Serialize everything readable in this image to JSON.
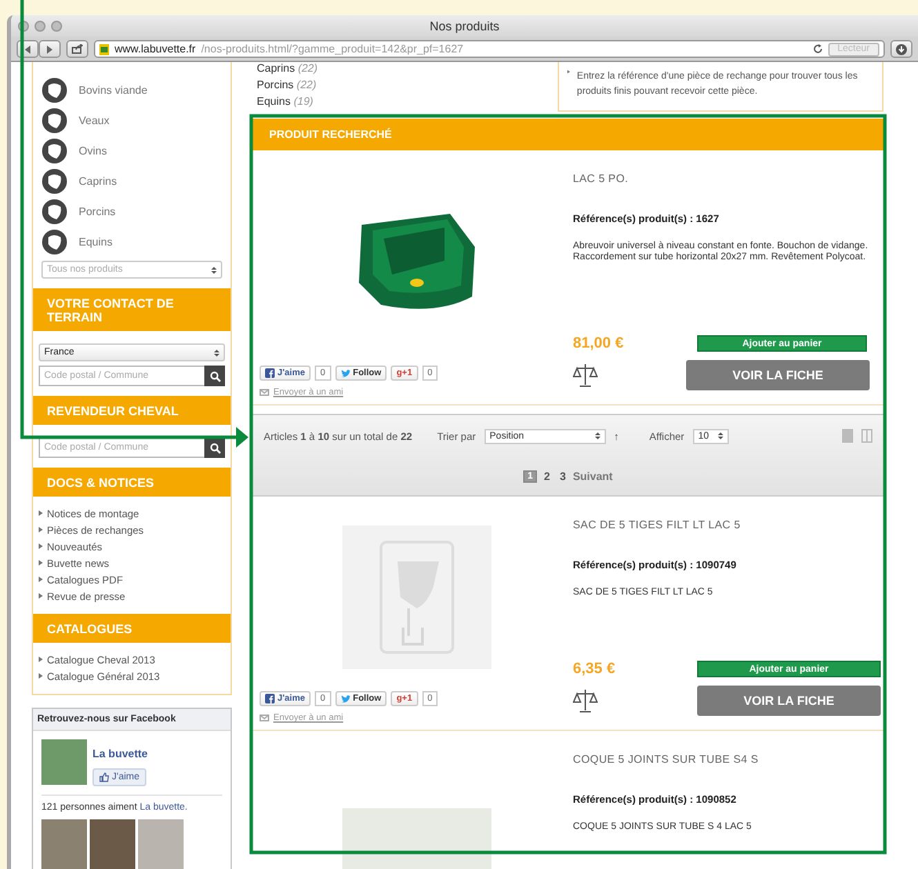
{
  "browser": {
    "title": "Nos produits",
    "url_domain": "www.labuvette.fr",
    "url_path": "/nos-produits.html/?gamme_produit=142&pr_pf=1627",
    "reader_button": "Lecteur"
  },
  "sidebar": {
    "categories": [
      {
        "label": "Bovins viande"
      },
      {
        "label": "Veaux"
      },
      {
        "label": "Ovins"
      },
      {
        "label": "Caprins"
      },
      {
        "label": "Porcins"
      },
      {
        "label": "Equins"
      }
    ],
    "product_select": {
      "value": "Tous nos produits"
    },
    "sections": [
      {
        "kind": "contact",
        "title": "VOTRE CONTACT DE TERRAIN",
        "country": "France",
        "placeholder": "Code postal / Commune"
      },
      {
        "kind": "search",
        "title": "REVENDEUR CHEVAL",
        "placeholder": "Code postal / Commune"
      },
      {
        "kind": "links",
        "title": "DOCS & NOTICES",
        "links": [
          "Notices de montage",
          "Pièces de rechanges",
          "Nouveautés",
          "Buvette news",
          "Catalogues PDF",
          "Revue de presse"
        ]
      },
      {
        "kind": "links",
        "title": "CATALOGUES",
        "links": [
          "Catalogue Cheval 2013",
          "Catalogue Général 2013"
        ]
      }
    ],
    "facebook": {
      "title": "Retrouvez-nous sur Facebook",
      "page_name": "La buvette",
      "like_button": "J'aime",
      "likes_text": "121 personnes aiment",
      "likes_link": "La buvette."
    }
  },
  "main": {
    "filters": [
      {
        "label": "Caprins",
        "count": "(22)"
      },
      {
        "label": "Porcins",
        "count": "(22)"
      },
      {
        "label": "Equins",
        "count": "(19)"
      }
    ],
    "hint": "Entrez la référence d'une pièce de rechange pour trouver tous les produits finis pouvant recevoir cette pièce.",
    "featured_title": "PRODUIT RECHERCHÉ",
    "toolbar": {
      "summary": "Articles **1** à **10** sur un total de **22**",
      "sort_label": "Trier par",
      "sort_value": "Position",
      "sort_arrow": "↑",
      "show_label": "Afficher",
      "show_value": "10"
    },
    "pagination": [
      {
        "label": "1",
        "selected": true
      },
      {
        "label": "2",
        "selected": false
      },
      {
        "label": "3",
        "selected": false
      }
    ],
    "next_link": "Suivant",
    "products": [
      {
        "kind": "trough",
        "name": "LAC 5 PO.",
        "reference": "Référence(s) produit(s) : 1627",
        "description": "Abreuvoir universel à niveau constant en fonte. Bouchon de vidange. Raccordement sur tube horizontal 20x27 mm. Revêtement Polycoat.",
        "price": "81,00 €",
        "cart_button": "Ajouter au panier",
        "details_button": "VOIR LA FICHE",
        "like": "J'aime",
        "like_count": "0",
        "follow": "Follow",
        "plus": "g+1",
        "plus_count": "0",
        "send_link": "Envoyer à un ami"
      },
      {
        "kind": "placeholder",
        "name": "SAC DE 5 TIGES FILT LT LAC 5",
        "reference": "Référence(s) produit(s) : 1090749",
        "description": "SAC DE 5 TIGES FILT LT LAC 5",
        "price": "6,35 €",
        "cart_button": "Ajouter au panier",
        "details_button": "VOIR LA FICHE",
        "like": "J'aime",
        "like_count": "0",
        "follow": "Follow",
        "plus": "g+1",
        "plus_count": "0",
        "send_link": "Envoyer à un ami"
      },
      {
        "kind": "photo",
        "name": "COQUE 5 JOINTS SUR TUBE S4 S",
        "reference": "Référence(s) produit(s) : 1090852",
        "description": "COQUE 5 JOINTS SUR TUBE S 4 LAC 5"
      }
    ]
  }
}
